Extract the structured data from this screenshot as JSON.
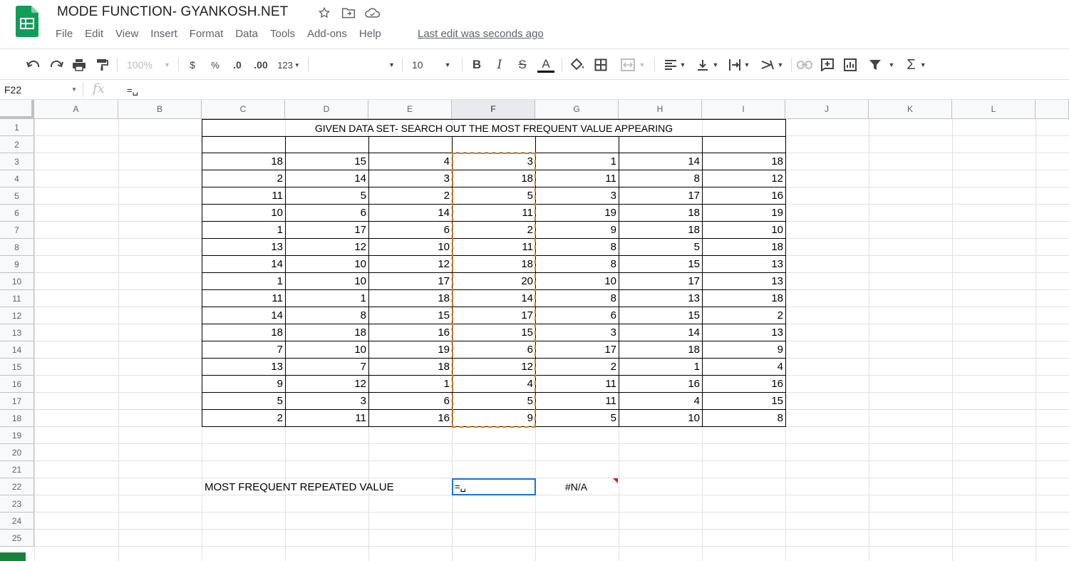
{
  "app": {
    "title": "MODE FUNCTION- GYANKOSH.NET",
    "last_edit": "Last edit was seconds ago",
    "menu": [
      "File",
      "Edit",
      "View",
      "Insert",
      "Format",
      "Data",
      "Tools",
      "Add-ons",
      "Help"
    ]
  },
  "toolbar": {
    "zoom": "100%",
    "currency": "$",
    "percent": "%",
    "decrease_decimals": ".0",
    "increase_decimals": ".00",
    "more_formats": "123",
    "font": "",
    "font_size": "10",
    "bold": "B",
    "italic": "I",
    "strikethrough": "S",
    "text_color": "A",
    "functions": "Σ",
    "colors": {
      "text_color_bar": "#000000",
      "accent": "#1a73e8",
      "copy_border": "#e37400",
      "logo": "#0f9d58"
    }
  },
  "formula_bar": {
    "name_box": "F22",
    "fx": "fx",
    "value": "=␣"
  },
  "sheet": {
    "columns": [
      "A",
      "B",
      "C",
      "D",
      "E",
      "F",
      "G",
      "H",
      "I",
      "J",
      "K",
      "L"
    ],
    "selected_column": "F",
    "rows": [
      "1",
      "2",
      "3",
      "4",
      "5",
      "6",
      "7",
      "8",
      "9",
      "10",
      "11",
      "12",
      "13",
      "14",
      "15",
      "16",
      "17",
      "18",
      "19",
      "20",
      "21",
      "22",
      "23",
      "24",
      "25"
    ],
    "table_title": "GIVEN DATA SET- SEARCH OUT THE MOST FREQUENT VALUE APPEARING",
    "data": [
      [
        "18",
        "15",
        "4",
        "3",
        "1",
        "14",
        "18"
      ],
      [
        "2",
        "14",
        "3",
        "18",
        "11",
        "8",
        "12"
      ],
      [
        "11",
        "5",
        "2",
        "5",
        "3",
        "17",
        "16"
      ],
      [
        "10",
        "6",
        "14",
        "11",
        "19",
        "18",
        "19"
      ],
      [
        "1",
        "17",
        "6",
        "2",
        "9",
        "18",
        "10"
      ],
      [
        "13",
        "12",
        "10",
        "11",
        "8",
        "5",
        "18"
      ],
      [
        "14",
        "10",
        "12",
        "18",
        "8",
        "15",
        "13"
      ],
      [
        "1",
        "10",
        "17",
        "20",
        "10",
        "17",
        "13"
      ],
      [
        "11",
        "1",
        "18",
        "14",
        "8",
        "13",
        "18"
      ],
      [
        "14",
        "8",
        "15",
        "17",
        "6",
        "15",
        "2"
      ],
      [
        "18",
        "18",
        "16",
        "15",
        "3",
        "14",
        "13"
      ],
      [
        "7",
        "10",
        "19",
        "6",
        "17",
        "18",
        "9"
      ],
      [
        "13",
        "7",
        "18",
        "12",
        "2",
        "1",
        "4"
      ],
      [
        "9",
        "12",
        "1",
        "4",
        "11",
        "16",
        "16"
      ],
      [
        "5",
        "3",
        "6",
        "5",
        "11",
        "4",
        "15"
      ],
      [
        "2",
        "11",
        "16",
        "9",
        "5",
        "10",
        "8"
      ]
    ],
    "result_label": "MOST FREQUENT REPEATED VALUE",
    "active_cell_value": "=␣",
    "error_value": "#N/A"
  }
}
